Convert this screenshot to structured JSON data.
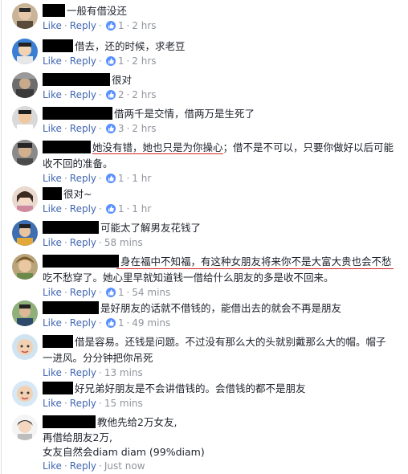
{
  "labels": {
    "like": "Like",
    "reply": "Reply",
    "dot": "·"
  },
  "comments": [
    {
      "lines": [
        "一般有借没还"
      ],
      "likes": "1",
      "time": "2 hrs"
    },
    {
      "lines": [
        "借去，还的时候，求老豆"
      ],
      "likes": "1",
      "time": "2 hrs"
    },
    {
      "lines": [
        "很对"
      ],
      "likes": "2",
      "time": "2 hrs"
    },
    {
      "lines": [
        "借两千是交情，借两万是生死了"
      ],
      "likes": "3",
      "time": "2 hrs"
    },
    {
      "line1_underlined": "她没有错，她也只是为你操心",
      "line1_rest": "；借不是不可以，只要你做好以后可能",
      "line2": "收不回的准备。",
      "likes": "1",
      "time": "1 hr"
    },
    {
      "lines": [
        "很对~"
      ],
      "likes": "1",
      "time": "1 hr"
    },
    {
      "lines": [
        "可能太了解男友花钱了"
      ],
      "likes": null,
      "time": "58 mins"
    },
    {
      "line1": "身在福中不知福，有这种女朋友将来你不是大富大贵也会不愁",
      "line2": "吃不愁穿了。她心里早就知道钱一借给什么朋友的多是收不回来。",
      "likes": "1",
      "time": "54 mins"
    },
    {
      "lines": [
        "是好朋友的话就不借钱的，能借出去的就会不再是朋友"
      ],
      "likes": "1",
      "time": "49 mins"
    },
    {
      "line1": "借是容易。还钱是问题。不过没有那么大的头就别戴那么大的帽。帽子",
      "line2": "一进风。分分钟把你吊死",
      "likes": null,
      "time": "13 mins"
    },
    {
      "lines": [
        "好兄弟好朋友是不会讲借钱的。会借钱的都不是朋友"
      ],
      "likes": null,
      "time": "15 mins"
    },
    {
      "line1": "教他先给2万女友,",
      "line2": "再借给朋友2万,",
      "line3": "女友自然会diam diam (99%diam)",
      "likes": null,
      "time": "Just now"
    }
  ],
  "colors": {
    "link": "#4267b2",
    "meta": "#90949c",
    "like_badge": "#5890ff",
    "underline": "#d0252b",
    "redaction": "#000000"
  }
}
